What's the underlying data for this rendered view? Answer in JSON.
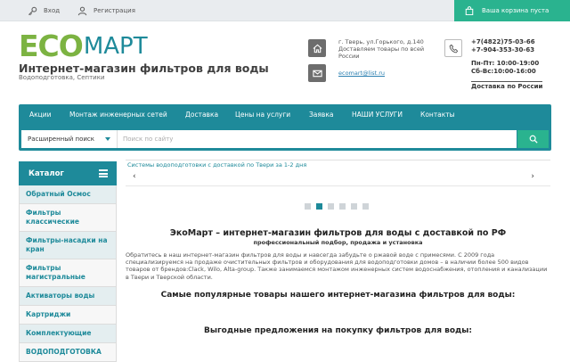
{
  "topbar": {
    "login": "Вход",
    "register": "Регистрация",
    "cart": "Ваша корзина пуста"
  },
  "header": {
    "logo_eco": "ECO",
    "logo_mart": "МАРТ",
    "title": "Интернет-магазин фильтров для воды",
    "subtitle": "Водоподготовка, Септики",
    "address_line1": "г. Тверь, ул.Горького, д.140",
    "address_line2": "Доставляем товары по всей России",
    "email": "ecomart@list.ru",
    "phone1": "+7(4822)75-03-66",
    "phone2": "+7-904-353-30-63",
    "hours1": "Пн-Пт: 10:00-19:00",
    "hours2": "Сб-Вс:10:00-16:00",
    "delivery": "Доставка по России"
  },
  "nav": {
    "items": [
      "Акции",
      "Монтаж инженерных сетей",
      "Доставка",
      "Цены на услуги",
      "Заявка",
      "НАШИ УСЛУГИ",
      "Контакты"
    ]
  },
  "search": {
    "mode": "Расширенный поиск",
    "placeholder": "Поиск по сайту"
  },
  "sidebar": {
    "title": "Каталог",
    "items": [
      "Обратный Осмос",
      "Фильтры классические",
      "Фильтры-насадки на кран",
      "Фильтры магистральные",
      "Активаторы воды",
      "Картриджи",
      "Комплектующие",
      "ВОДОПОДГОТОВКА"
    ]
  },
  "slider": {
    "text": "Системы водоподготовки с доставкой по Твери за 1-2 дня",
    "prev": "‹",
    "next": "›",
    "active_dot": 1,
    "dot_count": 6
  },
  "content": {
    "heading": "ЭкоМарт – интернет-магазин фильтров для воды с доставкой по РФ",
    "subheading": "профессиональный подбор, продажа и установка",
    "paragraph": "Обратитесь в наш интернет-магазин фильтров для воды и навсегда забудьте о ржавой воде с примесями. С 2009 года специализируемся на продаже очистительных фильтров и оборудования для водоподготовки домов – в наличии более 500 видов товаров от брендов:Clack, Wilo, Alta-group. Также занимаемся монтажом инженерных систем водоснабжения, отопления и канализации в Твери и Тверской области.",
    "popular": "Самые популярные товары нашего интернет-магазина фильтров для воды:",
    "offers": "Выгодные предложения на покупку фильтров для воды:"
  }
}
